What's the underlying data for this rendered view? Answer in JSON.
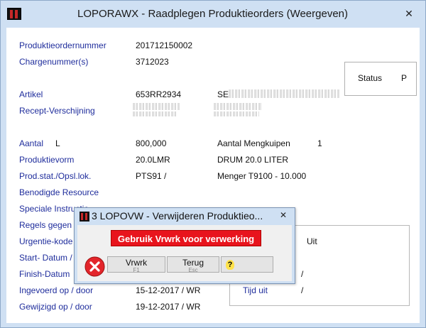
{
  "window": {
    "title": "LOPORAWX - Raadplegen Produktieorders (Weergeven)",
    "close_glyph": "✕"
  },
  "fields": {
    "order_label": "Produktieordernummer",
    "order_value": "201712150002",
    "charge_label": "Chargenummer(s)",
    "charge_value": "3712023",
    "artikel_label": "Artikel",
    "artikel_value": "653RR2934",
    "artikel_desc_prefix": "SE",
    "recept_label": "Recept-Verschijning",
    "aantal_label": "Aantal",
    "aantal_unit": "L",
    "aantal_value": "800,000",
    "mengkuipen_label": "Aantal Mengkuipen",
    "mengkuipen_value": "1",
    "vorm_label": "Produktievorm",
    "vorm_value": "20.0LMR",
    "vorm_desc": "DRUM 20.0 LITER",
    "stat_label": "Prod.stat./Opsl.lok.",
    "stat_value": "PTS91 /",
    "stat_desc": "Menger T9100 - 10.000",
    "resource_label": "Benodigde Resource",
    "instructie_label": "Speciale Instructie",
    "regels_label": "Regels gegen",
    "urgentie_label": "Urgentie-kode",
    "start_label": "Start- Datum /",
    "finish_label": "Finish-Datum",
    "ingevoerd_label": "Ingevoerd op / door",
    "ingevoerd_value": "15-12-2017 / WR",
    "gewijzigd_label": "Gewijzigd op / door",
    "gewijzigd_value": "19-12-2017 / WR"
  },
  "status": {
    "label": "Status",
    "value": "P"
  },
  "group": {
    "uit_value": "Uit",
    "slash_value_1": "/",
    "tijd_uit_label": "Tijd uit",
    "slash_value_2": "/"
  },
  "dialog": {
    "title": "3 LOPOVW - Verwijderen Produktieo...",
    "close_glyph": "✕",
    "message": "Gebruik Vrwrk voor verwerking",
    "buttons": [
      {
        "label": "Vrwrk",
        "key": "F1"
      },
      {
        "label": "Terug",
        "key": "Esc"
      },
      {
        "label": "?",
        "key": ""
      }
    ]
  },
  "icons": {
    "app_logo": "app-logo-icon",
    "error": "error-icon",
    "help": "question-icon"
  },
  "colors": {
    "label_blue": "#1f2d9c",
    "message_red": "#e8141d",
    "window_bg": "#cfe0f3"
  }
}
